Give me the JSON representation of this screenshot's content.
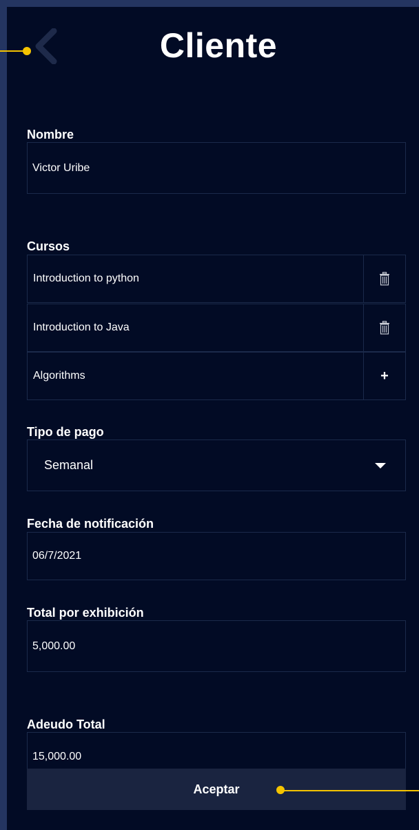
{
  "header": {
    "title": "Cliente",
    "back_icon": "chevron-left-icon"
  },
  "nombre": {
    "label": "Nombre",
    "value": "Victor Uribe"
  },
  "cursos": {
    "label": "Cursos",
    "items": [
      {
        "name": "Introduction to python",
        "action": "trash-icon"
      },
      {
        "name": "Introduction to Java",
        "action": "trash-icon"
      },
      {
        "name": "Algorithms",
        "action": "+"
      }
    ]
  },
  "tipo_pago": {
    "label": "Tipo de pago",
    "value": "Semanal"
  },
  "fecha_notificacion": {
    "label": "Fecha de notificación",
    "value": "06/7/2021"
  },
  "total_exhibicion": {
    "label": "Total por exhibición",
    "value": "5,000.00"
  },
  "adeudo_total": {
    "label": "Adeudo Total",
    "value": "15,000.00"
  },
  "accept_button": {
    "label": "Aceptar"
  },
  "colors": {
    "frame": "#243561",
    "background": "#020b25",
    "field_border": "#1b2a4b",
    "button": "#1a2440",
    "callout": "#f5c400"
  }
}
